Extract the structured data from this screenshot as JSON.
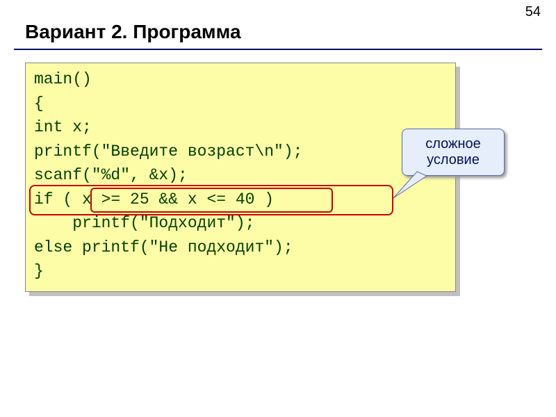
{
  "page_number": "54",
  "title": "Вариант 2. Программа",
  "code": {
    "l1": "main()",
    "l2": "{",
    "l3": "int x;",
    "l4": "printf(\"Введите возраст\\n\");",
    "l5": "scanf(\"%d\", &x);",
    "l6": "if ( x >= 25 && x <= 40 )",
    "l7": "    printf(\"Подходит\");",
    "l8": "else printf(\"Не подходит\");",
    "l9": "}"
  },
  "callout": {
    "line1": "сложное",
    "line2": "условие"
  }
}
